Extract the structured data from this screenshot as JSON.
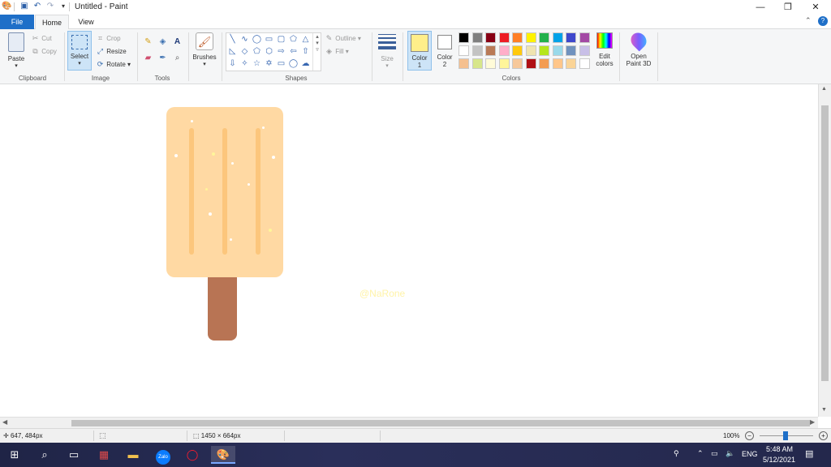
{
  "window": {
    "title": "Untitled - Paint"
  },
  "tabs": {
    "file": "File",
    "home": "Home",
    "view": "View"
  },
  "clipboard": {
    "paste": "Paste",
    "cut": "Cut",
    "copy": "Copy",
    "group": "Clipboard"
  },
  "image": {
    "select": "Select",
    "crop": "Crop",
    "resize": "Resize",
    "rotate": "Rotate",
    "group": "Image"
  },
  "tools": {
    "group": "Tools"
  },
  "brushes": {
    "label": "Brushes"
  },
  "shapes": {
    "outline": "Outline",
    "fill": "Fill",
    "group": "Shapes"
  },
  "size": {
    "label": "Size"
  },
  "colors": {
    "color1_label": "Color",
    "color1_num": "1",
    "color2_label": "Color",
    "color2_num": "2",
    "color1_value": "#ffee8a",
    "color2_value": "#ffffff",
    "palette_row1": [
      "#000000",
      "#7f7f7f",
      "#880015",
      "#ed1c24",
      "#ff7f27",
      "#fff200",
      "#22b14c",
      "#00a2e8",
      "#3f48cc",
      "#a349a4"
    ],
    "palette_row2": [
      "#ffffff",
      "#c3c3c3",
      "#b97a57",
      "#ffaec9",
      "#ffc90e",
      "#efe4b0",
      "#b5e61d",
      "#99d9ea",
      "#7092be",
      "#c8bfe7"
    ],
    "palette_row3": [
      "#f5c08f",
      "#d7e68a",
      "#fffbd8",
      "#fff59a",
      "#f7c89a",
      "#b01015",
      "#f39c52",
      "#ffc68a",
      "#fad497",
      "#ffffff"
    ],
    "edit_label1": "Edit",
    "edit_label2": "colors",
    "group": "Colors"
  },
  "paint3d": {
    "label1": "Open",
    "label2": "Paint 3D"
  },
  "canvas": {
    "watermark": "@NaRone",
    "popsicle_color": "#ffd9a3",
    "stick_color": "#b87454"
  },
  "status": {
    "cursor": "647, 484px",
    "dimensions": "1450 × 664px",
    "zoom": "100%"
  },
  "taskbar": {
    "lang": "ENG",
    "time": "5:48 AM",
    "date": "5/12/2021",
    "zalo": "Zalo"
  }
}
